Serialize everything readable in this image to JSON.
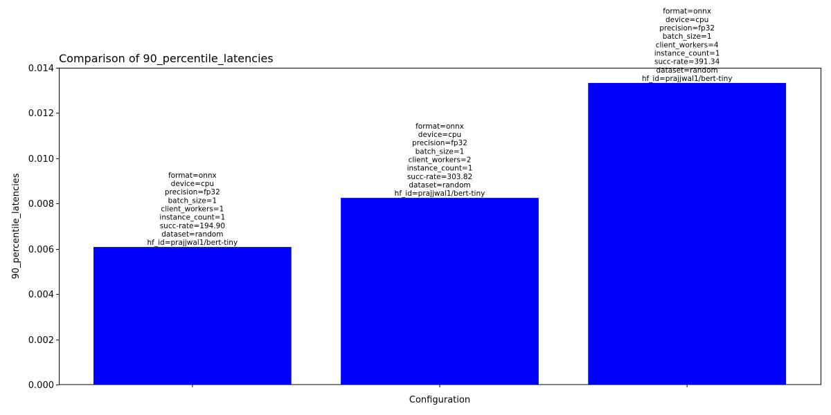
{
  "chart_data": {
    "type": "bar",
    "title": "Comparison of 90_percentile_latencies",
    "xlabel": "Configuration",
    "ylabel": "90_percentile_latencies",
    "ylim": [
      0,
      0.014
    ],
    "yticks": [
      "0.000",
      "0.002",
      "0.004",
      "0.006",
      "0.008",
      "0.010",
      "0.012",
      "0.014"
    ],
    "ytick_values": [
      0,
      0.002,
      0.004,
      0.006,
      0.008,
      0.01,
      0.012,
      0.014
    ],
    "categories": [
      "",
      "",
      ""
    ],
    "values": [
      0.00608,
      0.00825,
      0.01333
    ],
    "bar_color": "#0000ff",
    "grid": false,
    "bar_labels": [
      [
        "format=onnx",
        "device=cpu",
        "precision=fp32",
        "batch_size=1",
        "client_workers=1",
        "instance_count=1",
        "succ-rate=194.90",
        "dataset=random",
        "hf_id=prajjwal1/bert-tiny"
      ],
      [
        "format=onnx",
        "device=cpu",
        "precision=fp32",
        "batch_size=1",
        "client_workers=2",
        "instance_count=1",
        "succ-rate=303.82",
        "dataset=random",
        "hf_id=prajjwal1/bert-tiny"
      ],
      [
        "format=onnx",
        "device=cpu",
        "precision=fp32",
        "batch_size=1",
        "client_workers=4",
        "instance_count=1",
        "succ-rate=391.34",
        "dataset=random",
        "hf_id=prajjwal1/bert-tiny"
      ]
    ]
  }
}
